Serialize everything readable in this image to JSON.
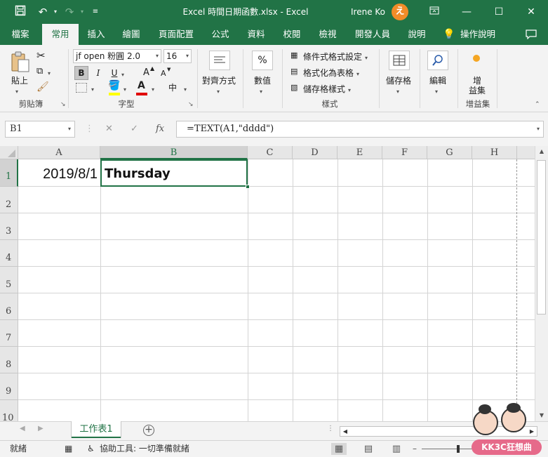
{
  "window": {
    "title": "Excel 時間日期函數.xlsx  -  Excel",
    "user_name": "Irene Ko",
    "avatar_letter": "え",
    "minimize": "—",
    "restore": "⧉",
    "maximize": "☐",
    "close": "✕"
  },
  "tabs": [
    "檔案",
    "常用",
    "插入",
    "繪圖",
    "頁面配置",
    "公式",
    "資料",
    "校閱",
    "檢視",
    "開發人員",
    "說明",
    "操作說明"
  ],
  "active_tab": "常用",
  "ribbon": {
    "clipboard": {
      "paste": "貼上",
      "group": "剪貼簿"
    },
    "font": {
      "name": "jf open 粉圓 2.0",
      "size": "16",
      "bold": "B",
      "italic": "I",
      "underline": "U",
      "grow": "A",
      "shrink": "A",
      "color_a": "A",
      "phonetic": "中",
      "group": "字型"
    },
    "alignment": {
      "label": "對齊方式"
    },
    "number": {
      "label": "數值",
      "symbol": "%"
    },
    "styles": {
      "conditional": "條件式格式設定",
      "as_table": "格式化為表格",
      "cell_styles": "儲存格樣式",
      "group": "樣式"
    },
    "cells": {
      "label": "儲存格"
    },
    "editing": {
      "label": "編輯"
    },
    "addins": {
      "label1": "增",
      "label2": "益集",
      "group": "增益集"
    }
  },
  "formula_bar": {
    "name_box": "B1",
    "cancel": "✕",
    "enter": "✓",
    "fx": "fx",
    "formula": "=TEXT(A1,\"dddd\")"
  },
  "columns": [
    "A",
    "B",
    "C",
    "D",
    "E",
    "F",
    "G",
    "H"
  ],
  "rows": [
    "1",
    "2",
    "3",
    "4",
    "5",
    "6",
    "7",
    "8",
    "9",
    "10"
  ],
  "cells": {
    "A1": "2019/8/1",
    "B1": "Thursday"
  },
  "selected_cell": "B1",
  "sheet": {
    "tab": "工作表1",
    "add": "+"
  },
  "status": {
    "ready": "就緒",
    "accessibility": "協助工具: 一切準備就緒"
  },
  "watermark": "KK3C狂想曲"
}
